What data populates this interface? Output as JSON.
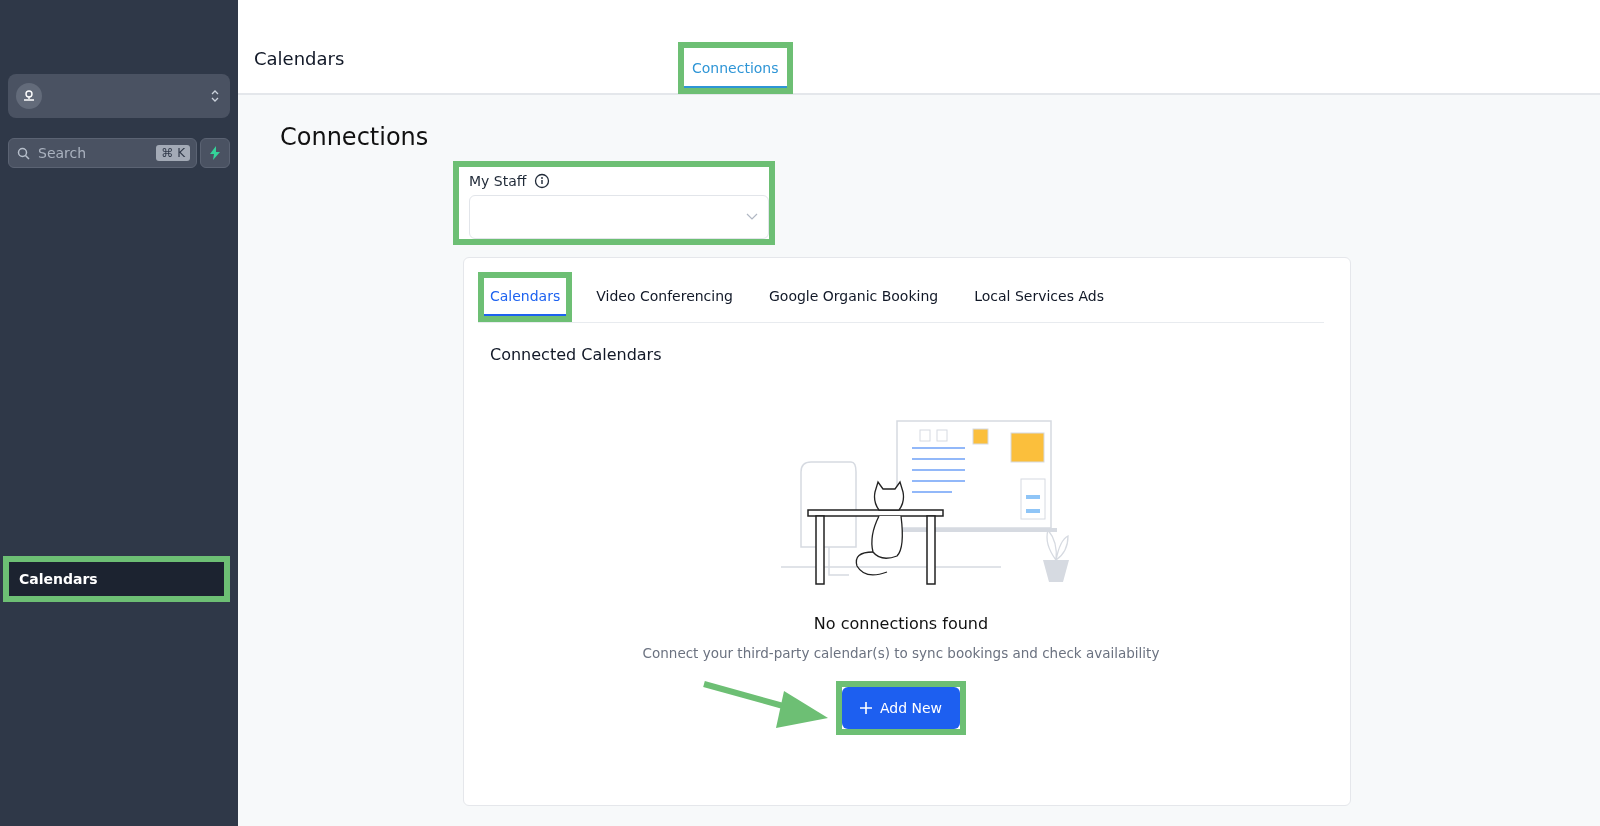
{
  "sidebar": {
    "search": {
      "placeholder": "Search",
      "shortcut": "⌘ K"
    },
    "items": [
      {
        "label": "Calendars",
        "selected": true,
        "highlighted": true
      }
    ]
  },
  "header": {
    "title": "Calendars",
    "tabs": [
      {
        "label": "Connections",
        "selected": true,
        "highlighted": true
      }
    ]
  },
  "page_title": "Connections",
  "staff_field": {
    "label": "My Staff",
    "highlighted": true
  },
  "card": {
    "tabs": [
      {
        "label": "Calendars",
        "selected": true,
        "highlighted": true
      },
      {
        "label": "Video Conferencing",
        "selected": false,
        "highlighted": false
      },
      {
        "label": "Google Organic Booking",
        "selected": false,
        "highlighted": false
      },
      {
        "label": "Local Services Ads",
        "selected": false,
        "highlighted": false
      }
    ],
    "section_title": "Connected Calendars",
    "empty_state": {
      "title": "No connections found",
      "message": "Connect your third-party calendar(s) to sync bookings and check availability"
    },
    "button": {
      "label": "Add New",
      "highlighted": true,
      "pointer_arrow": true
    }
  }
}
